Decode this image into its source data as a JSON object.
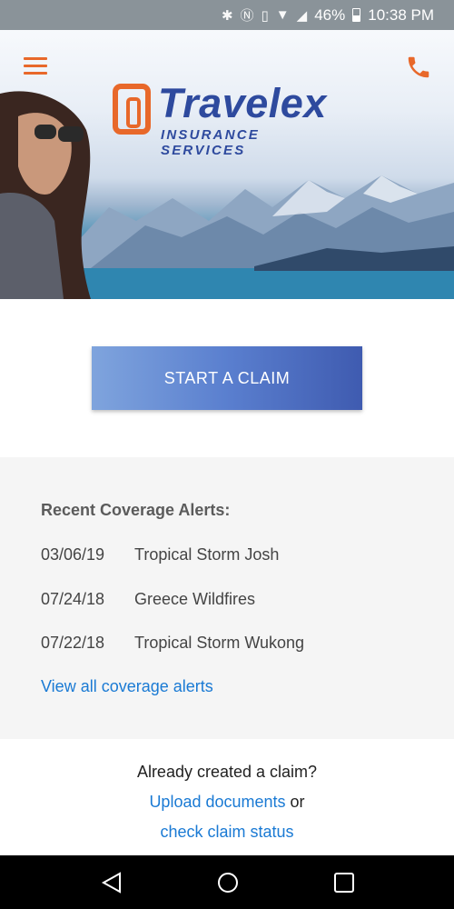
{
  "status_bar": {
    "icons": [
      "bluetooth-icon",
      "nfc-icon",
      "vibrate-icon",
      "wifi-icon",
      "signal-icon"
    ],
    "battery": "46%",
    "time": "10:38 PM"
  },
  "header": {
    "menu_icon": "hamburger-menu-icon",
    "phone_icon": "phone-icon",
    "logo": {
      "name": "Travelex",
      "tagline": "INSURANCE SERVICES"
    }
  },
  "cta": {
    "label": "START A CLAIM"
  },
  "alerts": {
    "title": "Recent Coverage Alerts:",
    "items": [
      {
        "date": "03/06/19",
        "name": "Tropical Storm Josh"
      },
      {
        "date": "07/24/18",
        "name": "Greece Wildfires"
      },
      {
        "date": "07/22/18",
        "name": "Tropical Storm Wukong"
      }
    ],
    "view_all": "View all coverage alerts"
  },
  "footer": {
    "question": "Already created a claim?",
    "upload_link": "Upload documents",
    "or": "or",
    "status_link": "check claim status"
  },
  "nav": {
    "back": "back-icon",
    "home": "home-icon",
    "recents": "recents-icon"
  },
  "colors": {
    "accent": "#e8682a",
    "brand": "#2e4a9e",
    "link": "#1a7ad4"
  }
}
